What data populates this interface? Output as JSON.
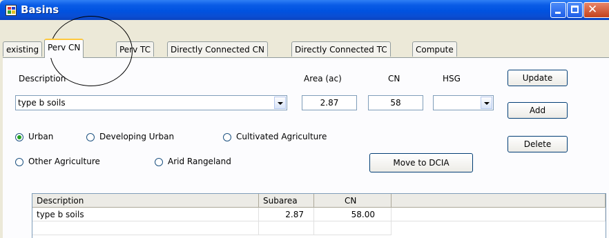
{
  "window": {
    "title": "Basins"
  },
  "tabs": [
    {
      "label": "existing"
    },
    {
      "label": "Perv CN"
    },
    {
      "label": "Perv TC"
    },
    {
      "label": "Directly Connected CN"
    },
    {
      "label": "Directly Connected TC"
    },
    {
      "label": "Compute"
    }
  ],
  "form": {
    "description_label": "Description",
    "description_value": "type b soils",
    "area_label": "Area (ac)",
    "area_value": "2.87",
    "cn_label": "CN",
    "cn_value": "58",
    "hsg_label": "HSG",
    "hsg_value": ""
  },
  "buttons": {
    "update": "Update",
    "add": "Add",
    "delete": "Delete",
    "move_to_dcia": "Move to DCIA"
  },
  "land_use": {
    "selected": "Urban",
    "options": [
      "Urban",
      "Developing Urban",
      "Cultivated Agriculture",
      "Other Agriculture",
      "Arid Rangeland"
    ]
  },
  "grid": {
    "columns": [
      "Description",
      "Subarea",
      "CN"
    ],
    "rows": [
      {
        "description": "type b soils",
        "subarea": "2.87",
        "cn": "58.00"
      }
    ]
  }
}
